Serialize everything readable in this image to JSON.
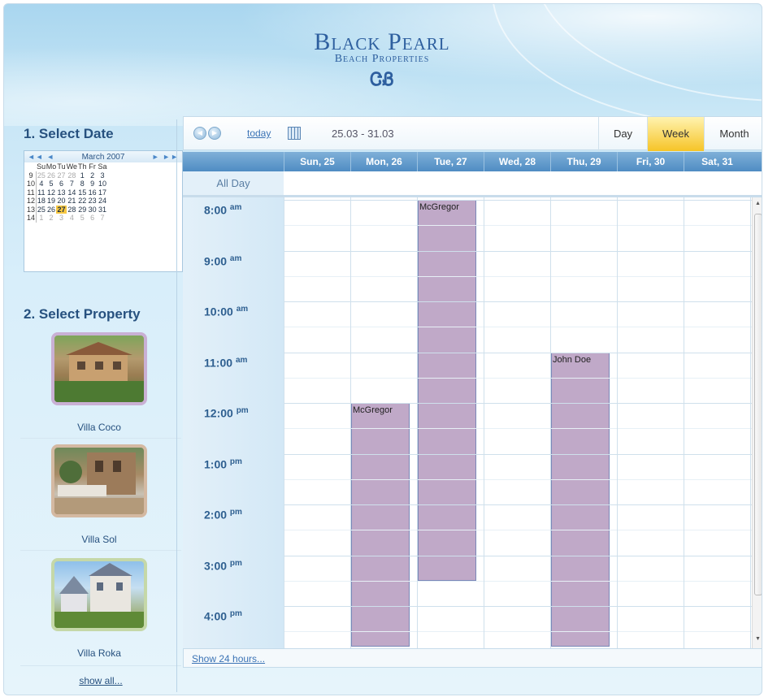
{
  "brand": {
    "title": "Black Pearl",
    "subtitle": "Beach Properties",
    "logo_glyph": "ᏣᏰ"
  },
  "left": {
    "step1_title": "1. Select Date",
    "step2_title": "2. Select Property",
    "show_all": "show all..."
  },
  "mini_calendar": {
    "month_label": "March 2007",
    "prev_nav": "◄◄ ◄",
    "next_nav": "► ►►",
    "dow": [
      "",
      "Su",
      "Mo",
      "Tu",
      "We",
      "Th",
      "Fr",
      "Sa"
    ],
    "weeks": [
      {
        "wk": "9",
        "days": [
          "25",
          "26",
          "27",
          "28",
          "1",
          "2",
          "3"
        ],
        "other": [
          true,
          true,
          true,
          true,
          false,
          false,
          false
        ]
      },
      {
        "wk": "10",
        "days": [
          "4",
          "5",
          "6",
          "7",
          "8",
          "9",
          "10"
        ],
        "other": [
          false,
          false,
          false,
          false,
          false,
          false,
          false
        ]
      },
      {
        "wk": "11",
        "days": [
          "11",
          "12",
          "13",
          "14",
          "15",
          "16",
          "17"
        ],
        "other": [
          false,
          false,
          false,
          false,
          false,
          false,
          false
        ]
      },
      {
        "wk": "12",
        "days": [
          "18",
          "19",
          "20",
          "21",
          "22",
          "23",
          "24"
        ],
        "other": [
          false,
          false,
          false,
          false,
          false,
          false,
          false
        ]
      },
      {
        "wk": "13",
        "days": [
          "25",
          "26",
          "27",
          "28",
          "29",
          "30",
          "31"
        ],
        "other": [
          false,
          false,
          false,
          false,
          false,
          false,
          false
        ]
      },
      {
        "wk": "14",
        "days": [
          "1",
          "2",
          "3",
          "4",
          "5",
          "6",
          "7"
        ],
        "other": [
          true,
          true,
          true,
          true,
          true,
          true,
          true
        ]
      }
    ],
    "selected_day": "27"
  },
  "properties": [
    {
      "name": "Villa Coco"
    },
    {
      "name": "Villa Sol"
    },
    {
      "name": "Villa Roka"
    }
  ],
  "toolbar": {
    "today_label": "today",
    "date_range": "25.03 - 31.03",
    "views": [
      "Day",
      "Week",
      "Month"
    ],
    "active_view": "Week"
  },
  "days": [
    "Sun, 25",
    "Mon, 26",
    "Tue, 27",
    "Wed, 28",
    "Thu, 29",
    "Fri, 30",
    "Sat, 31"
  ],
  "allday_label": "All Day",
  "times": [
    {
      "h": "8:00",
      "ap": "am"
    },
    {
      "h": "9:00",
      "ap": "am"
    },
    {
      "h": "10:00",
      "ap": "am"
    },
    {
      "h": "11:00",
      "ap": "am"
    },
    {
      "h": "12:00",
      "ap": "pm"
    },
    {
      "h": "1:00",
      "ap": "pm"
    },
    {
      "h": "2:00",
      "ap": "pm"
    },
    {
      "h": "3:00",
      "ap": "pm"
    },
    {
      "h": "4:00",
      "ap": "pm"
    }
  ],
  "appointments": [
    {
      "title": "McGregor",
      "day_index": 2,
      "start_hour": 8.0,
      "end_hour": 15.5
    },
    {
      "title": "McGregor",
      "day_index": 1,
      "start_hour": 12.0,
      "end_hour": 16.8
    },
    {
      "title": "John Doe",
      "day_index": 4,
      "start_hour": 11.0,
      "end_hour": 16.8
    }
  ],
  "footer": {
    "show24_label": "Show 24 hours..."
  },
  "colors": {
    "appointment": "#c0a9c8",
    "active_tab": "#f6c427",
    "day_header": "#4f8cc3"
  }
}
